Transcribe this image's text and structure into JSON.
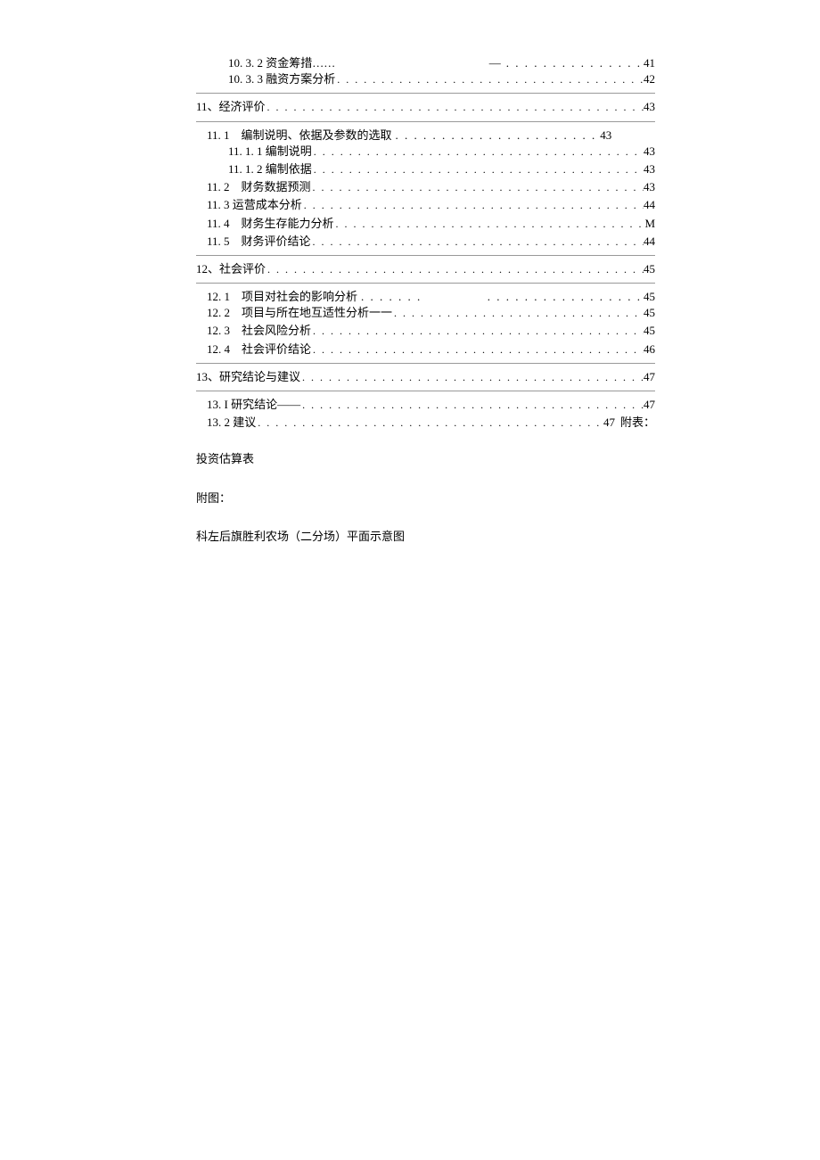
{
  "toc": {
    "item_10_3_2": {
      "label": "10. 3. 2 资金筹措……",
      "dash": "—",
      "page": "41"
    },
    "item_10_3_3": {
      "label": "10. 3. 3 融资方案分析",
      "page": "42"
    },
    "item_11": {
      "label": "11、经济评价",
      "page": "43"
    },
    "item_11_1": {
      "label": "11. 1　编制说明、依据及参数的选取",
      "page": "43"
    },
    "item_11_1_1": {
      "label": "11. 1. 1 编制说明",
      "page": "43"
    },
    "item_11_1_2": {
      "label": "11. 1. 2 编制依据",
      "page": "43"
    },
    "item_11_2": {
      "label": "11. 2　财务数据预测",
      "page": "43"
    },
    "item_11_3": {
      "label": "11. 3 运营成本分析",
      "page": "44"
    },
    "item_11_4": {
      "label": "11. 4　财务生存能力分析",
      "page": "M"
    },
    "item_11_5": {
      "label": "11. 5　财务评价结论",
      "page": "44"
    },
    "item_12": {
      "label": "12、社会评价",
      "page": "45"
    },
    "item_12_1": {
      "label": "12. 1　项目对社会的影响分析",
      "page": "45"
    },
    "item_12_2": {
      "label": "12. 2　项目与所在地互适性分析一一",
      "page": "45"
    },
    "item_12_3": {
      "label": "12. 3　社会风险分析",
      "page": "45"
    },
    "item_12_4": {
      "label": "12. 4　社会评价结论",
      "page": "46"
    },
    "item_13": {
      "label": "13、研究结论与建议",
      "page": "47"
    },
    "item_13_1": {
      "label": "13. I 研究结论——",
      "page": "47"
    },
    "item_13_2": {
      "label": "13. 2 建议",
      "page": "47",
      "trailing": "附表："
    }
  },
  "body": {
    "line1": "投资估算表",
    "line2": "附图：",
    "line3": "科左后旗胜利农场（二分场）平面示意图"
  }
}
